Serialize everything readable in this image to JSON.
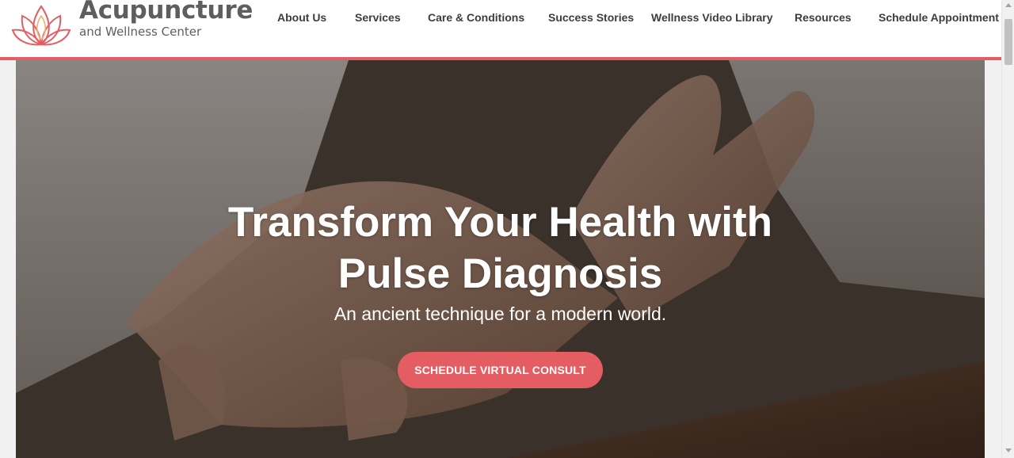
{
  "brand": {
    "title": "Acupuncture",
    "subtitle": "and Wellness Center",
    "logo_icon": "lotus-icon",
    "accent_color": "#e35d63"
  },
  "nav": {
    "items": [
      {
        "label": "About Us"
      },
      {
        "label": "Services"
      },
      {
        "label": "Care & Conditions"
      },
      {
        "label": "Success Stories"
      },
      {
        "label": "Wellness Video Library"
      },
      {
        "label": "Resources"
      },
      {
        "label": "Schedule Appointment"
      }
    ]
  },
  "hero": {
    "title_line1": "Transform Your Health with",
    "title_line2": "Pulse Diagnosis",
    "subtitle": "An ancient technique for a modern world.",
    "cta_label": "SCHEDULE VIRTUAL CONSULT",
    "image_icon": "hands-pulse-diagnosis-photo"
  }
}
